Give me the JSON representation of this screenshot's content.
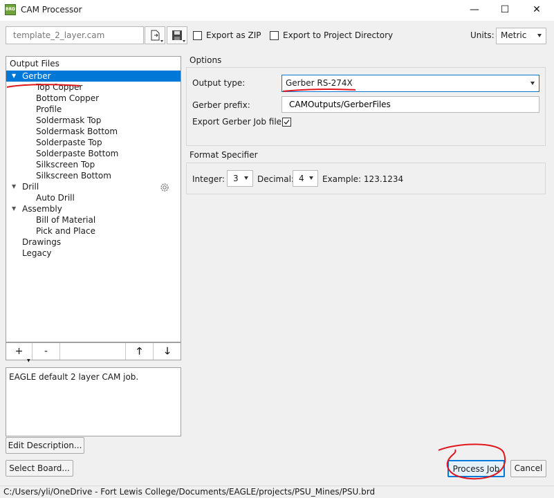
{
  "window": {
    "title": "CAM Processor",
    "app_icon_text": "BRD",
    "controls": {
      "minimize": "—",
      "maximize": "☐",
      "close": "✕"
    }
  },
  "toolbar": {
    "file_name": "template_2_layer.cam",
    "export_zip_label": "Export as ZIP",
    "export_project_label": "Export to Project Directory",
    "units_label": "Units:",
    "units_value": "Metric"
  },
  "tree": {
    "header": "Output Files",
    "items": [
      {
        "label": "Gerber",
        "level": 0,
        "expanded": true,
        "selected": true
      },
      {
        "label": "Top Copper",
        "level": 1
      },
      {
        "label": "Bottom Copper",
        "level": 1
      },
      {
        "label": "Profile",
        "level": 1
      },
      {
        "label": "Soldermask Top",
        "level": 1
      },
      {
        "label": "Soldermask Bottom",
        "level": 1
      },
      {
        "label": "Solderpaste Top",
        "level": 1
      },
      {
        "label": "Solderpaste Bottom",
        "level": 1
      },
      {
        "label": "Silkscreen Top",
        "level": 1
      },
      {
        "label": "Silkscreen Bottom",
        "level": 1
      },
      {
        "label": "Drill",
        "level": 0,
        "expanded": true
      },
      {
        "label": "Auto Drill",
        "level": 1
      },
      {
        "label": "Assembly",
        "level": 0,
        "expanded": true
      },
      {
        "label": "Bill of Material",
        "level": 1
      },
      {
        "label": "Pick and Place",
        "level": 1
      },
      {
        "label": "Drawings",
        "level": 0
      },
      {
        "label": "Legacy",
        "level": 0
      }
    ],
    "buttons": {
      "add": "+",
      "remove": "-",
      "up": "🡑",
      "down": "🡓"
    }
  },
  "description": "EAGLE default 2 layer CAM job.",
  "buttons": {
    "edit_description": "Edit Description...",
    "select_board": "Select Board...",
    "process_job": "Process Job",
    "cancel": "Cancel"
  },
  "options": {
    "title": "Options",
    "output_type_label": "Output type:",
    "output_type_value": "Gerber RS-274X",
    "gerber_prefix_label": "Gerber prefix:",
    "gerber_prefix_value": "CAMOutputs/GerberFiles",
    "export_job_label": "Export Gerber Job file:",
    "export_job_checked": true
  },
  "format": {
    "title": "Format Specifier",
    "integer_label": "Integer:",
    "integer_value": "3",
    "decimal_label": "Decimal:",
    "decimal_value": "4",
    "example_label": "Example: 123.1234"
  },
  "status_path": "C:/Users/yli/OneDrive - Fort Lewis College/Documents/EAGLE/projects/PSU_Mines/PSU.brd",
  "annotation_color": "#e0161b"
}
